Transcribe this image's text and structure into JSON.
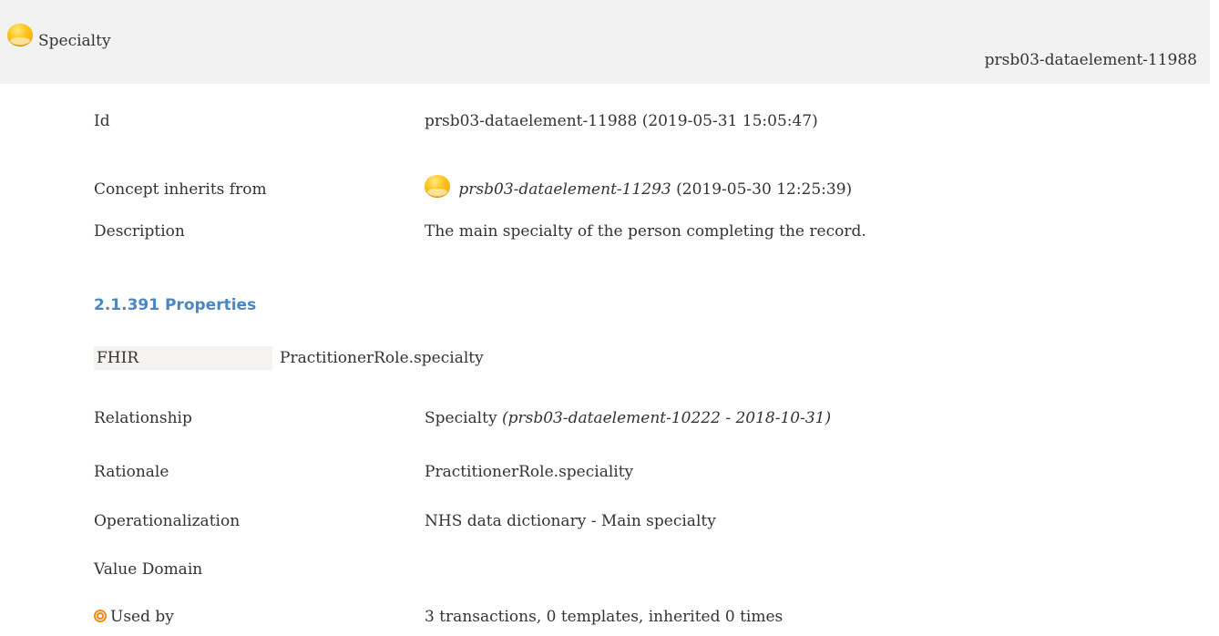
{
  "header": {
    "title": "Specialty",
    "id": "prsb03-dataelement-11988"
  },
  "details": {
    "id_label": "Id",
    "id_value": "prsb03-dataelement-11988 (2019-05-31 15:05:47)",
    "inherits_label": "Concept inherits from",
    "inherits_ref": "prsb03-dataelement-11293",
    "inherits_date": "(2019-05-30 12:25:39)",
    "description_label": "Description",
    "description_value": "The main specialty of the person completing the record."
  },
  "properties": {
    "section_title": "2.1.391 Properties",
    "fhir_label": "FHIR",
    "fhir_value": "PractitionerRole.specialty",
    "relationship_label": "Relationship",
    "relationship_value": "Specialty",
    "relationship_ref": "(prsb03-dataelement-10222 - 2018-10-31)",
    "rationale_label": "Rationale",
    "rationale_value": "PractitionerRole.speciality",
    "operationalization_label": "Operationalization",
    "operationalization_value": "NHS data dictionary - Main specialty",
    "value_domain_label": "Value Domain",
    "value_domain_value": "",
    "used_by_label": "Used by",
    "used_by_value": "3 transactions, 0 templates, inherited 0 times"
  },
  "icons": {
    "concept_icon": "yellow-orb-icon",
    "used_by_icon": "target-icon"
  }
}
